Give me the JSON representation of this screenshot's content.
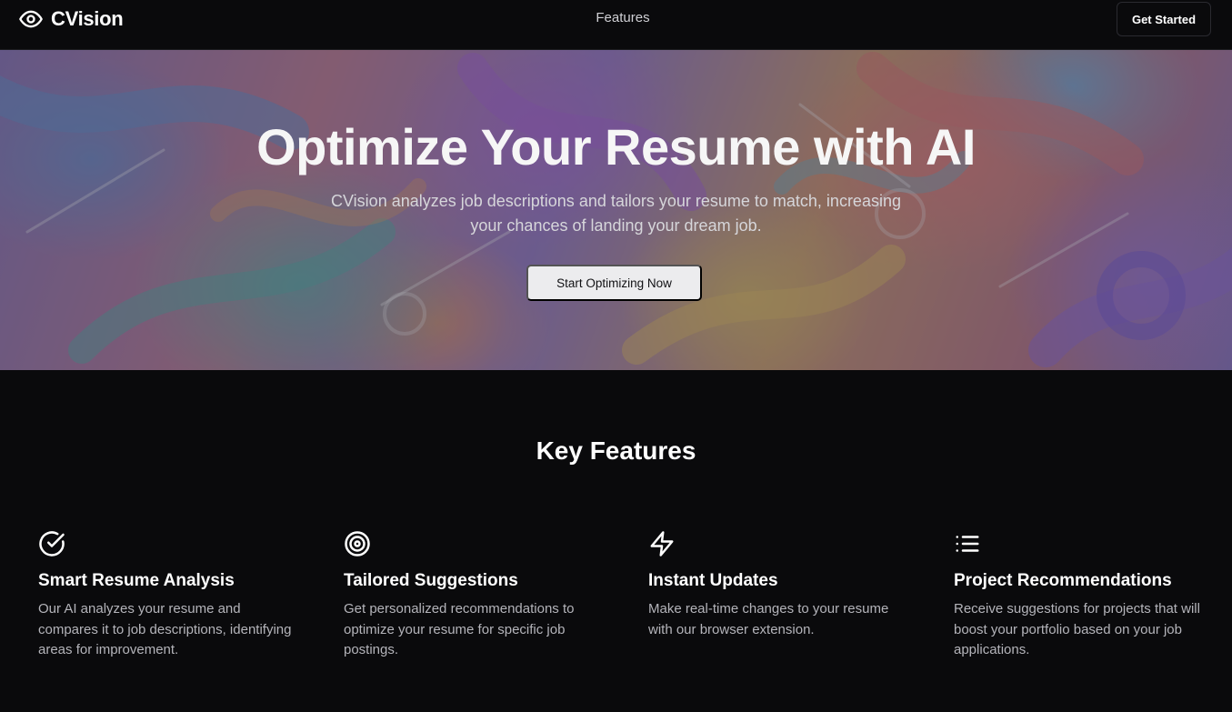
{
  "nav": {
    "brand": "CVision",
    "brand_icon": "eye-icon",
    "links": [
      "Features"
    ],
    "cta": "Get Started"
  },
  "hero": {
    "title": "Optimize Your Resume with AI",
    "subtitle": "CVision analyzes job descriptions and tailors your resume to match, increasing your chances of landing your dream job.",
    "cta": "Start Optimizing Now"
  },
  "features": {
    "heading": "Key Features",
    "items": [
      {
        "icon": "check-circle-icon",
        "title": "Smart Resume Analysis",
        "description": "Our AI analyzes your resume and compares it to job descriptions, identifying areas for improvement."
      },
      {
        "icon": "target-icon",
        "title": "Tailored Suggestions",
        "description": "Get personalized recommendations to optimize your resume for specific job postings."
      },
      {
        "icon": "lightning-icon",
        "title": "Instant Updates",
        "description": "Make real-time changes to your resume with our browser extension."
      },
      {
        "icon": "list-icon",
        "title": "Project Recommendations",
        "description": "Receive suggestions for projects that will boost your portfolio based on your job applications."
      }
    ]
  },
  "colors": {
    "background": "#0a0a0c",
    "text": "#ffffff",
    "muted_text": "#b4b4ba",
    "hero_button_bg": "#ececee"
  }
}
